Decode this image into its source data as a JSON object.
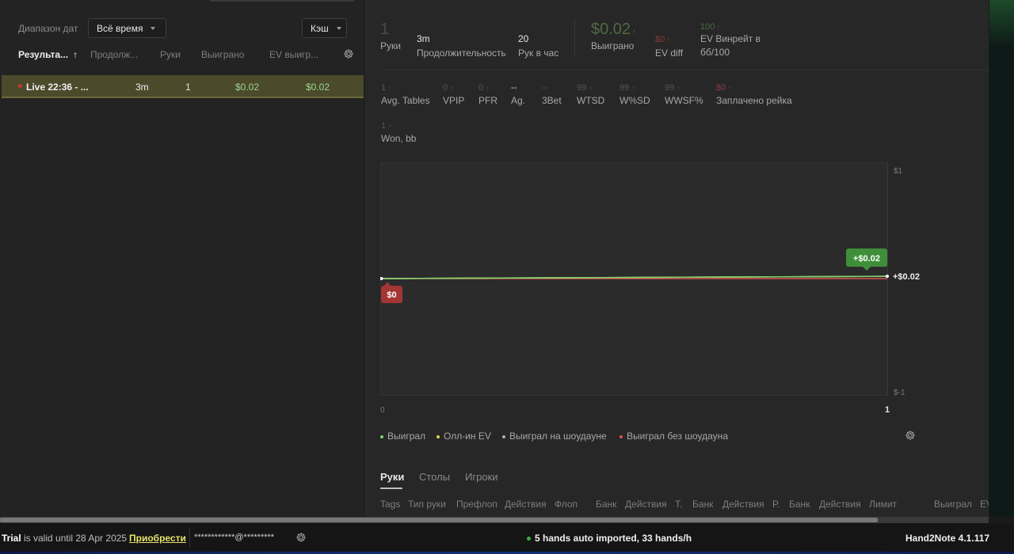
{
  "left_panel": {
    "date_range_label": "Диапазон дат",
    "date_range_value": "Всё время",
    "game_type_value": "Кэш",
    "columns": [
      "Результа...",
      "Продолж...",
      "Руки",
      "Выиграно",
      "EV выигр..."
    ],
    "sort_arrow": "↑",
    "rows": [
      {
        "name": "Live 22:36 - ...",
        "duration": "3m",
        "hands": "1",
        "won": "$0.02",
        "ev_won": "$0.02"
      }
    ]
  },
  "summary": {
    "hands_value": "1",
    "hands_label": "Руки",
    "duration_value": "3m",
    "duration_label": "Продолжительность",
    "hands_per_hour_value": "20",
    "hands_per_hour_label": "Рук в час",
    "won_value": "$0.02",
    "won_arrow": "↑",
    "won_label": "Выиграно",
    "ev_diff_value": "$0",
    "ev_diff_arrow": "↑",
    "ev_diff_label": "EV diff",
    "ev_winrate_value": "100",
    "ev_winrate_arrow": "↑",
    "ev_winrate_label": "EV Винрейт в",
    "ev_winrate_label2": "бб/100"
  },
  "stats": [
    {
      "value": "1",
      "arrow": "↑",
      "label": "Avg. Tables"
    },
    {
      "value": "0",
      "arrow": "↑",
      "label": "VPIP"
    },
    {
      "value": "0",
      "arrow": "↑",
      "label": "PFR"
    },
    {
      "value": "--",
      "arrow": "",
      "label": "Ag."
    },
    {
      "value": "--",
      "arrow": "",
      "label": "3Bet"
    },
    {
      "value": "99",
      "arrow": "↑",
      "label": "WTSD"
    },
    {
      "value": "99",
      "arrow": "↑",
      "label": "W%SD"
    },
    {
      "value": "99",
      "arrow": "↑",
      "label": "WWSF%"
    },
    {
      "value": "$0",
      "arrow": "↑",
      "label": "Заплачено рейка"
    }
  ],
  "won_bb": {
    "value": "1",
    "arrow": "↑",
    "label": "Won, bb"
  },
  "chart_data": {
    "type": "line",
    "x": [
      0,
      1
    ],
    "xlim": [
      0,
      1
    ],
    "ylim": [
      -1,
      1
    ],
    "y_tick_labels": [
      "$1",
      "$-1"
    ],
    "x_tick_labels": [
      "0",
      "1"
    ],
    "series": [
      {
        "name": "Выиграл",
        "values": [
          0,
          0.02
        ],
        "color": "#7ed36f"
      },
      {
        "name": "Олл-ин EV",
        "values": [
          0,
          0.02
        ],
        "color": "#e0d24a"
      },
      {
        "name": "Выиграл на шоудауне",
        "values": [
          0,
          0.02
        ],
        "color": "#b0b0b0"
      },
      {
        "name": "Выиграл без шоудауна",
        "values": [
          0,
          0.0
        ],
        "color": "#d9534f"
      }
    ],
    "start_label": "$0",
    "end_badge": "+$0.02",
    "end_label": "+$0.02"
  },
  "legend": [
    {
      "label": "Выиграл",
      "color": "#7ed36f"
    },
    {
      "label": "Олл-ин EV",
      "color": "#e0d24a"
    },
    {
      "label": "Выиграл на шоудауне",
      "color": "#b0b0b0"
    },
    {
      "label": "Выиграл без шоудауна",
      "color": "#d9534f"
    }
  ],
  "tabs": [
    "Руки",
    "Столы",
    "Игроки"
  ],
  "hands_columns": [
    "Tags",
    "Тип руки",
    "Префлоп",
    "Действия",
    "Флоп",
    "Банк",
    "Действия",
    "Т.",
    "Банк",
    "Действия",
    "Р.",
    "Банк",
    "Действия",
    "Лимит",
    "Выиграл",
    "EV"
  ],
  "status_bar": {
    "trial": "Trial",
    "valid_text": "is valid until 28 Apr 2025",
    "buy_link": "Приобрести",
    "email": "************@*********",
    "import_text": "5 hands auto imported, 33 hands/h",
    "version": "Hand2Note 4.1.117"
  },
  "colors": {
    "accent_green": "#3f8f3a",
    "accent_red": "#a33535",
    "selected_row": "#4b4a2b"
  }
}
